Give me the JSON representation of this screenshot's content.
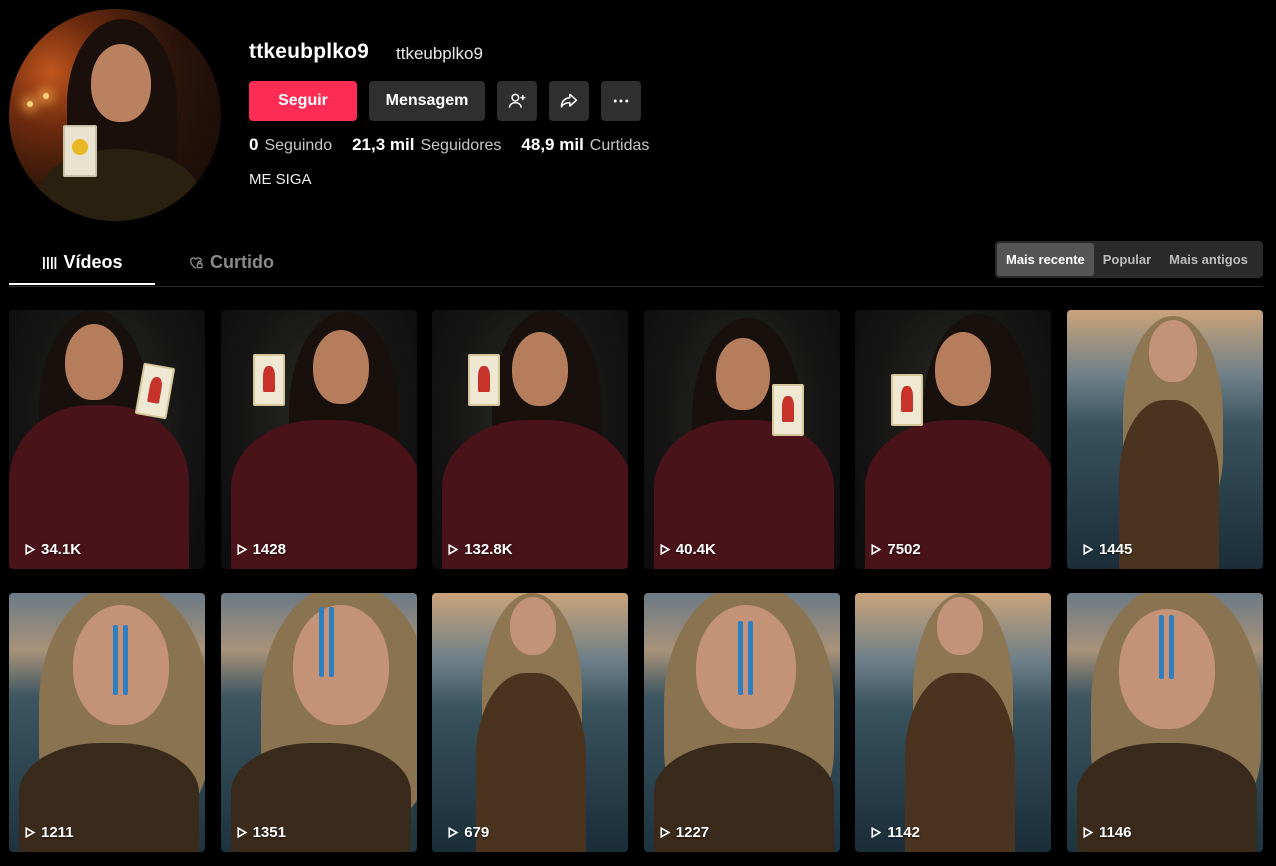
{
  "profile": {
    "username": "ttkeubplko9",
    "nickname": "ttkeubplko9",
    "bio": "ME SIGA",
    "stats": [
      {
        "value": "0",
        "label": "Seguindo"
      },
      {
        "value": "21,3 mil",
        "label": "Seguidores"
      },
      {
        "value": "48,9 mil",
        "label": "Curtidas"
      }
    ]
  },
  "actions": {
    "follow_label": "Seguir",
    "message_label": "Mensagem",
    "icons": [
      "add-friend-icon",
      "share-icon",
      "more-icon"
    ]
  },
  "tabs": [
    {
      "label": "Vídeos",
      "icon": "grid-bars-icon",
      "active": true
    },
    {
      "label": "Curtido",
      "icon": "heart-lock-icon",
      "active": false
    }
  ],
  "sort": {
    "options": [
      "Mais recente",
      "Popular",
      "Mais antigos"
    ],
    "selected": "Mais recente"
  },
  "videos": [
    {
      "views": "34.1K",
      "scene": "tarot"
    },
    {
      "views": "1428",
      "scene": "tarot"
    },
    {
      "views": "132.8K",
      "scene": "tarot"
    },
    {
      "views": "40.4K",
      "scene": "tarot"
    },
    {
      "views": "7502",
      "scene": "tarot"
    },
    {
      "views": "1445",
      "scene": "sea"
    },
    {
      "views": "1211",
      "scene": "sea-closeup"
    },
    {
      "views": "1351",
      "scene": "sea-closeup"
    },
    {
      "views": "679",
      "scene": "sea"
    },
    {
      "views": "1227",
      "scene": "sea-closeup"
    },
    {
      "views": "1142",
      "scene": "sea"
    },
    {
      "views": "1146",
      "scene": "sea-closeup"
    }
  ],
  "colors": {
    "accent": "#fe2c55",
    "background": "#000000",
    "button_secondary": "#2f2f2f"
  }
}
